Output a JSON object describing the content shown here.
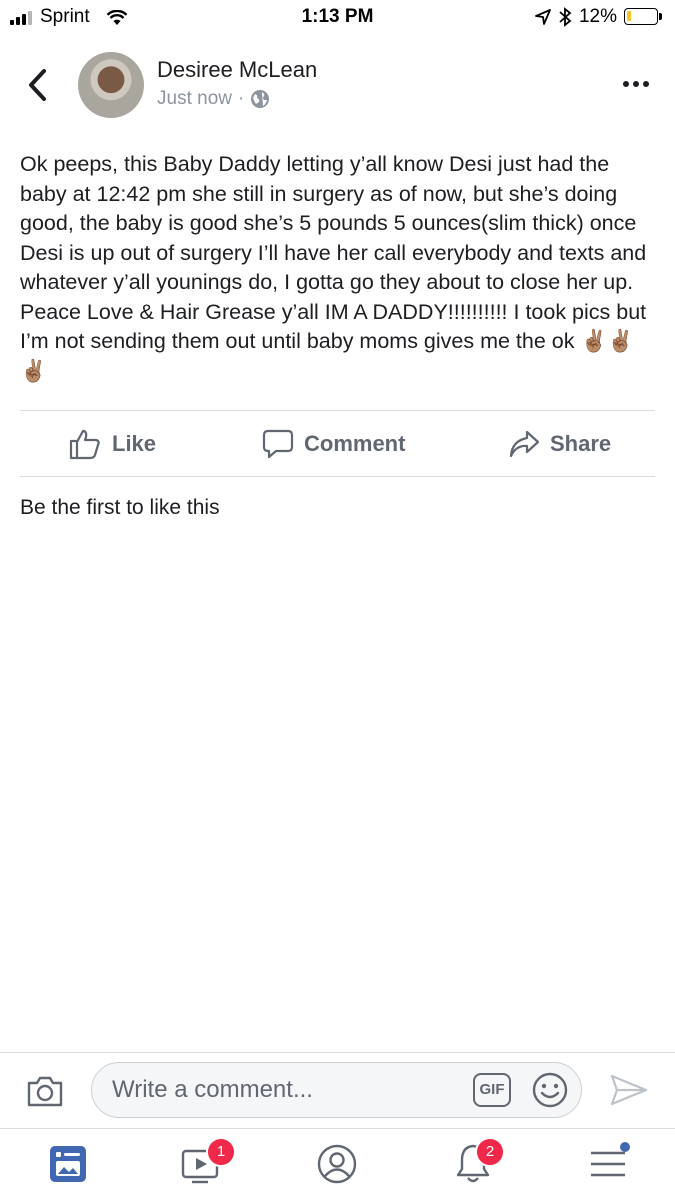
{
  "status_bar": {
    "carrier": "Sprint",
    "time": "1:13 PM",
    "battery_percent": "12%"
  },
  "post": {
    "author": "Desiree McLean",
    "timestamp": "Just now",
    "separator": "·",
    "text": "Ok peeps, this Baby Daddy letting y’all know Desi just had the baby at 12:42 pm she still in surgery as of now, but she’s doing good, the baby is good she’s 5 pounds 5 ounces(slim thick) once Desi is up out of surgery I’ll have her call everybody and texts and whatever y’all younings do, I gotta go they about to close her up. Peace Love & Hair Grease y’all IM A DADDY!!!!!!!!!! I took pics but I’m not sending them out until baby moms gives me the ok ✌🏽✌🏽✌🏽"
  },
  "actions": {
    "like": "Like",
    "comment": "Comment",
    "share": "Share"
  },
  "reactions_summary": "Be the first to like this",
  "comment_input": {
    "placeholder": "Write a comment...",
    "gif_label": "GIF"
  },
  "tabbar": {
    "watch_badge": "1",
    "notifications_badge": "2"
  },
  "icons": [
    "back-icon",
    "more-icon",
    "globe-icon",
    "like-icon",
    "comment-icon",
    "share-icon",
    "camera-icon",
    "gif-icon",
    "emoji-icon",
    "send-icon",
    "news-feed-icon",
    "watch-icon",
    "profile-icon",
    "notifications-icon",
    "menu-icon"
  ],
  "colors": {
    "facebook_blue": "#4267b2",
    "badge_red": "#f02849",
    "secondary_text": "#606770"
  }
}
